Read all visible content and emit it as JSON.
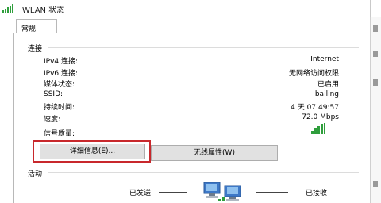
{
  "window": {
    "title": "WLAN 状态",
    "icon": "wifi-signal-icon"
  },
  "tabs": [
    {
      "label": "常规",
      "active": true
    }
  ],
  "connection": {
    "section_label": "连接",
    "rows": [
      {
        "label": "IPv4 连接:",
        "value": "Internet"
      },
      {
        "label": "IPv6 连接:",
        "value": "无网络访问权限"
      },
      {
        "label": "媒体状态:",
        "value": "已启用"
      },
      {
        "label": "SSID:",
        "value": "bailing"
      },
      {
        "label": "持续时间:",
        "value": "4 天 07:49:57"
      },
      {
        "label": "速度:",
        "value": "72.0 Mbps"
      }
    ],
    "signal_label": "信号质量:",
    "signal_icon": "signal-strength-icon",
    "signal_color": "#2f9e3c"
  },
  "buttons": {
    "details": "详细信息(E)...",
    "wireless_properties": "无线属性(W)"
  },
  "activity": {
    "section_label": "活动",
    "sent_label": "已发送",
    "received_label": "已接收",
    "icon": "network-computers-icon"
  },
  "colors": {
    "highlight": "#c8282c",
    "button_bg": "#e1e1e1"
  }
}
